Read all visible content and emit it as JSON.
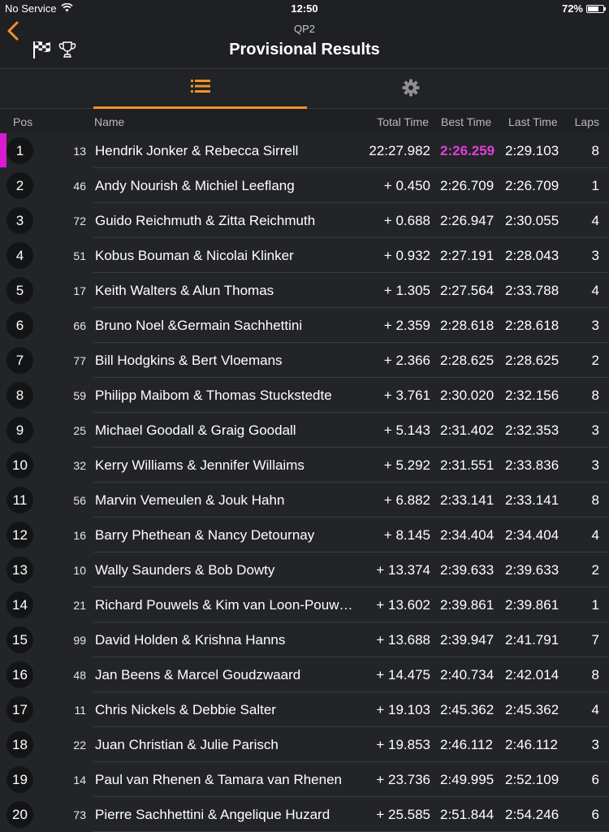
{
  "status": {
    "carrier": "No Service",
    "time": "12:50",
    "battery": "72%",
    "battery_level": 0.72
  },
  "nav": {
    "subtitle": "QP2",
    "title": "Provisional Results",
    "icons": [
      "back-chevron-icon",
      "checkered-flag-icon",
      "trophy-icon"
    ]
  },
  "tabs": [
    {
      "icon": "list-icon",
      "active": true
    },
    {
      "icon": "gear-icon",
      "active": false
    }
  ],
  "colors": {
    "accent": "#f0922a",
    "fastest": "#e23ed9",
    "background": "#1f2023"
  },
  "columns": {
    "pos": "Pos",
    "name": "Name",
    "total": "Total Time",
    "best": "Best Time",
    "last": "Last Time",
    "laps": "Laps"
  },
  "rows": [
    {
      "pos": "1",
      "num": "13",
      "name": "Hendrik Jonker & Rebecca Sirrell",
      "total": "22:27.982",
      "best": "2:26.259",
      "last": "2:29.103",
      "laps": "8",
      "fastest": true
    },
    {
      "pos": "2",
      "num": "46",
      "name": "Andy Nourish & Michiel Leeflang",
      "total": "+ 0.450",
      "best": "2:26.709",
      "last": "2:26.709",
      "laps": "1"
    },
    {
      "pos": "3",
      "num": "72",
      "name": "Guido Reichmuth & Zitta Reichmuth",
      "total": "+ 0.688",
      "best": "2:26.947",
      "last": "2:30.055",
      "laps": "4"
    },
    {
      "pos": "4",
      "num": "51",
      "name": "Kobus Bouman & Nicolai Klinker",
      "total": "+ 0.932",
      "best": "2:27.191",
      "last": "2:28.043",
      "laps": "3"
    },
    {
      "pos": "5",
      "num": "17",
      "name": "Keith Walters & Alun Thomas",
      "total": "+ 1.305",
      "best": "2:27.564",
      "last": "2:33.788",
      "laps": "4"
    },
    {
      "pos": "6",
      "num": "66",
      "name": "Bruno Noel &Germain Sachhettini",
      "total": "+ 2.359",
      "best": "2:28.618",
      "last": "2:28.618",
      "laps": "3"
    },
    {
      "pos": "7",
      "num": "77",
      "name": "Bill Hodgkins & Bert Vloemans",
      "total": "+ 2.366",
      "best": "2:28.625",
      "last": "2:28.625",
      "laps": "2"
    },
    {
      "pos": "8",
      "num": "59",
      "name": "Philipp Maibom & Thomas Stuckstedte",
      "total": "+ 3.761",
      "best": "2:30.020",
      "last": "2:32.156",
      "laps": "8"
    },
    {
      "pos": "9",
      "num": "25",
      "name": "Michael Goodall & Graig Goodall",
      "total": "+ 5.143",
      "best": "2:31.402",
      "last": "2:32.353",
      "laps": "3"
    },
    {
      "pos": "10",
      "num": "32",
      "name": "Kerry Williams & Jennifer Willaims",
      "total": "+ 5.292",
      "best": "2:31.551",
      "last": "2:33.836",
      "laps": "3"
    },
    {
      "pos": "11",
      "num": "56",
      "name": "Marvin Vemeulen & Jouk Hahn",
      "total": "+ 6.882",
      "best": "2:33.141",
      "last": "2:33.141",
      "laps": "8"
    },
    {
      "pos": "12",
      "num": "16",
      "name": "Barry Phethean & Nancy Detournay",
      "total": "+ 8.145",
      "best": "2:34.404",
      "last": "2:34.404",
      "laps": "4"
    },
    {
      "pos": "13",
      "num": "10",
      "name": "Wally Saunders & Bob Dowty",
      "total": "+ 13.374",
      "best": "2:39.633",
      "last": "2:39.633",
      "laps": "2"
    },
    {
      "pos": "14",
      "num": "21",
      "name": "Richard Pouwels & Kim van Loon-Pouw…",
      "total": "+ 13.602",
      "best": "2:39.861",
      "last": "2:39.861",
      "laps": "1"
    },
    {
      "pos": "15",
      "num": "99",
      "name": "David Holden & Krishna Hanns",
      "total": "+ 13.688",
      "best": "2:39.947",
      "last": "2:41.791",
      "laps": "7"
    },
    {
      "pos": "16",
      "num": "48",
      "name": "Jan Beens & Marcel Goudzwaard",
      "total": "+ 14.475",
      "best": "2:40.734",
      "last": "2:42.014",
      "laps": "8"
    },
    {
      "pos": "17",
      "num": "11",
      "name": "Chris Nickels & Debbie Salter",
      "total": "+ 19.103",
      "best": "2:45.362",
      "last": "2:45.362",
      "laps": "4"
    },
    {
      "pos": "18",
      "num": "22",
      "name": "Juan Christian & Julie Parisch",
      "total": "+ 19.853",
      "best": "2:46.112",
      "last": "2:46.112",
      "laps": "3"
    },
    {
      "pos": "19",
      "num": "14",
      "name": "Paul van Rhenen & Tamara van Rhenen",
      "total": "+ 23.736",
      "best": "2:49.995",
      "last": "2:52.109",
      "laps": "6"
    },
    {
      "pos": "20",
      "num": "73",
      "name": "Pierre Sachhettini & Angelique Huzard",
      "total": "+ 25.585",
      "best": "2:51.844",
      "last": "2:54.246",
      "laps": "6"
    }
  ]
}
